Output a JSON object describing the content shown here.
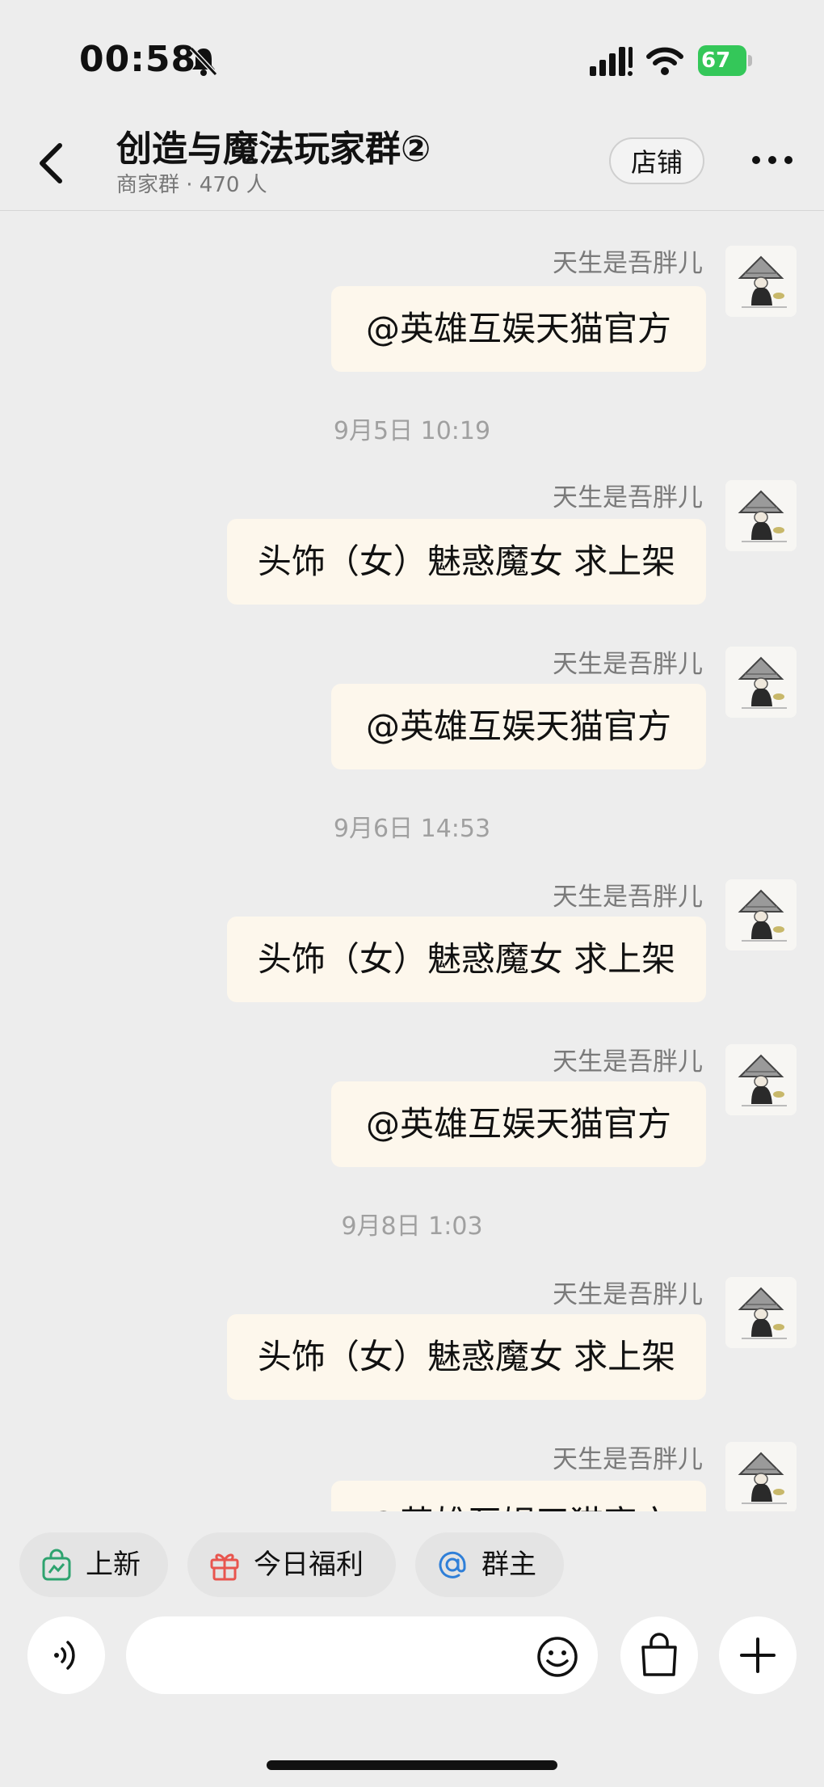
{
  "status_bar": {
    "time": "00:58",
    "battery": "67"
  },
  "header": {
    "title": "创造与魔法玩家群②",
    "subtitle": "商家群 · 470 人",
    "shop_label": "店铺"
  },
  "messages": [
    {
      "sender": "天生是吾胖儿",
      "text": "@英雄互娱天猫官方"
    },
    {
      "timestamp": "9月5日 10:19"
    },
    {
      "sender": "天生是吾胖儿",
      "text": "头饰（女）魅惑魔女  求上架"
    },
    {
      "sender": "天生是吾胖儿",
      "text": "@英雄互娱天猫官方"
    },
    {
      "timestamp": "9月6日 14:53"
    },
    {
      "sender": "天生是吾胖儿",
      "text": "头饰（女）魅惑魔女  求上架"
    },
    {
      "sender": "天生是吾胖儿",
      "text": "@英雄互娱天猫官方"
    },
    {
      "timestamp": "9月8日 1:03"
    },
    {
      "sender": "天生是吾胖儿",
      "text": "头饰（女）魅惑魔女  求上架"
    },
    {
      "sender": "天生是吾胖儿",
      "text": "@英雄互娱天猫官方"
    }
  ],
  "quick_actions": [
    {
      "label": "上新",
      "icon": "shopping-bag-icon"
    },
    {
      "label": "今日福利",
      "icon": "gift-icon"
    },
    {
      "label": "群主",
      "icon": "at-icon"
    }
  ],
  "input_bar": {
    "voice_icon": "voice-icon",
    "emoji_icon": "emoji-icon",
    "shop_icon": "shopping-bag-icon",
    "add_icon": "plus-icon"
  },
  "colors": {
    "background": "#ededed",
    "bubble": "#fdf7ec",
    "battery": "#34c759",
    "new_green": "#2ea36f",
    "gift_red": "#e8554e",
    "at_blue": "#2f7fd8"
  }
}
